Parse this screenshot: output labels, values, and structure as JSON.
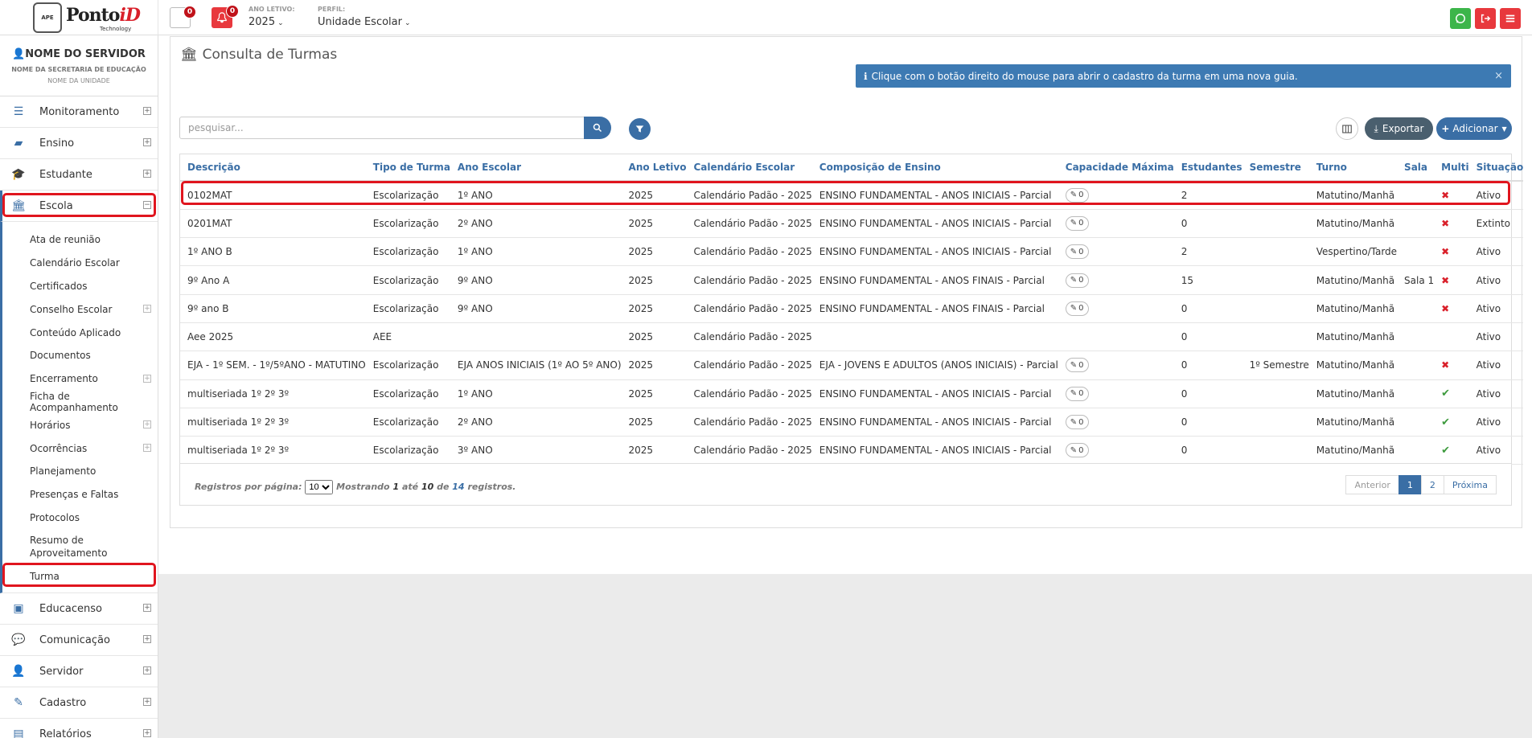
{
  "logo": {
    "badge": "APE",
    "brand_a": "Ponto",
    "brand_b": "iD",
    "tagline": "Technology"
  },
  "topbar": {
    "messages_count": "0",
    "notifications_count": "0",
    "ano_letivo_label": "ANO LETIVO:",
    "ano_letivo_value": "2025",
    "perfil_label": "PERFIL:",
    "perfil_value": "Unidade Escolar"
  },
  "user": {
    "name": "NOME DO SERVIDOR",
    "secretaria": "NOME DA SECRETARIA DE EDUCAÇÃO",
    "unidade": "NOME DA UNIDADE"
  },
  "sidebar": {
    "top_items": [
      {
        "label": "Monitoramento",
        "icon": "sliders-icon"
      },
      {
        "label": "Ensino",
        "icon": "book-icon"
      },
      {
        "label": "Estudante",
        "icon": "graduation-cap-icon"
      },
      {
        "label": "Escola",
        "icon": "institution-icon"
      }
    ],
    "escola_sub": [
      {
        "label": "Ata de reunião"
      },
      {
        "label": "Calendário Escolar"
      },
      {
        "label": "Certificados"
      },
      {
        "label": "Conselho Escolar"
      },
      {
        "label": "Conteúdo Aplicado"
      },
      {
        "label": "Documentos"
      },
      {
        "label": "Encerramento"
      },
      {
        "label": "Ficha de Acompanhamento"
      },
      {
        "label": "Horários"
      },
      {
        "label": "Ocorrências"
      },
      {
        "label": "Planejamento"
      },
      {
        "label": "Presenças e Faltas"
      },
      {
        "label": "Protocolos"
      },
      {
        "label": "Resumo de Aproveitamento"
      },
      {
        "label": "Turma"
      }
    ],
    "bottom_items": [
      {
        "label": "Educacenso",
        "icon": "monitor-icon"
      },
      {
        "label": "Comunicação",
        "icon": "chat-icon"
      },
      {
        "label": "Servidor",
        "icon": "user-icon"
      },
      {
        "label": "Cadastro",
        "icon": "edit-icon"
      },
      {
        "label": "Relatórios",
        "icon": "file-icon"
      }
    ]
  },
  "page": {
    "title": "Consulta de Turmas",
    "alert": "Clique com o botão direito do mouse para abrir o cadastro da turma em uma nova guia.",
    "search_placeholder": "pesquisar...",
    "export_label": "Exportar",
    "add_label": "Adicionar"
  },
  "table": {
    "headers": [
      "Descrição",
      "Tipo de Turma",
      "Ano Escolar",
      "Ano Letivo",
      "Calendário Escolar",
      "Composição de Ensino",
      "Capacidade Máxima",
      "Estudantes",
      "Semestre",
      "Turno",
      "Sala",
      "Multi",
      "Situação"
    ],
    "rows": [
      [
        "0102MAT",
        "Escolarização",
        "1º ANO",
        "2025",
        "Calendário Padão - 2025",
        "ENSINO FUNDAMENTAL - ANOS INICIAIS - Parcial",
        "0",
        "2",
        "",
        "Matutino/Manhã",
        "",
        "x",
        "Ativo"
      ],
      [
        "0201MAT",
        "Escolarização",
        "2º ANO",
        "2025",
        "Calendário Padão - 2025",
        "ENSINO FUNDAMENTAL - ANOS INICIAIS - Parcial",
        "0",
        "0",
        "",
        "Matutino/Manhã",
        "",
        "x",
        "Extinto"
      ],
      [
        "1º ANO B",
        "Escolarização",
        "1º ANO",
        "2025",
        "Calendário Padão - 2025",
        "ENSINO FUNDAMENTAL - ANOS INICIAIS - Parcial",
        "0",
        "2",
        "",
        "Vespertino/Tarde",
        "",
        "x",
        "Ativo"
      ],
      [
        "9º Ano A",
        "Escolarização",
        "9º ANO",
        "2025",
        "Calendário Padão - 2025",
        "ENSINO FUNDAMENTAL - ANOS FINAIS - Parcial",
        "0",
        "15",
        "",
        "Matutino/Manhã",
        "Sala 1",
        "x",
        "Ativo"
      ],
      [
        "9º ano B",
        "Escolarização",
        "9º ANO",
        "2025",
        "Calendário Padão - 2025",
        "ENSINO FUNDAMENTAL - ANOS FINAIS - Parcial",
        "0",
        "0",
        "",
        "Matutino/Manhã",
        "",
        "x",
        "Ativo"
      ],
      [
        "Aee 2025",
        "AEE",
        "",
        "2025",
        "Calendário Padão - 2025",
        "",
        "",
        "0",
        "",
        "Matutino/Manhã",
        "",
        "",
        "Ativo"
      ],
      [
        "EJA - 1º SEM. - 1º/5ºANO - MATUTINO",
        "Escolarização",
        "EJA ANOS INICIAIS (1º AO 5º ANO)",
        "2025",
        "Calendário Padão - 2025",
        "EJA - JOVENS E ADULTOS (ANOS INICIAIS) - Parcial",
        "0",
        "0",
        "1º Semestre",
        "Matutino/Manhã",
        "",
        "x",
        "Ativo"
      ],
      [
        "multiseriada 1º 2º 3º",
        "Escolarização",
        "1º ANO",
        "2025",
        "Calendário Padão - 2025",
        "ENSINO FUNDAMENTAL - ANOS INICIAIS - Parcial",
        "0",
        "0",
        "",
        "Matutino/Manhã",
        "",
        "check",
        "Ativo"
      ],
      [
        "multiseriada 1º 2º 3º",
        "Escolarização",
        "2º ANO",
        "2025",
        "Calendário Padão - 2025",
        "ENSINO FUNDAMENTAL - ANOS INICIAIS - Parcial",
        "0",
        "0",
        "",
        "Matutino/Manhã",
        "",
        "check",
        "Ativo"
      ],
      [
        "multiseriada 1º 2º 3º",
        "Escolarização",
        "3º ANO",
        "2025",
        "Calendário Padão - 2025",
        "ENSINO FUNDAMENTAL - ANOS INICIAIS - Parcial",
        "0",
        "0",
        "",
        "Matutino/Manhã",
        "",
        "check",
        "Ativo"
      ]
    ]
  },
  "footer": {
    "per_page_label": "Registros por página:",
    "per_page_value": "10",
    "showing_a": "Mostrando",
    "from": "1",
    "showing_b": "até",
    "to": "10",
    "showing_c": "de",
    "total": "14",
    "showing_d": "registros.",
    "prev": "Anterior",
    "pages": [
      "1",
      "2"
    ],
    "next": "Próxima"
  },
  "colors": {
    "primary": "#3a6ea5",
    "danger": "#e8383d",
    "whatsapp": "#3cb54a",
    "highlight": "#e0151e"
  }
}
